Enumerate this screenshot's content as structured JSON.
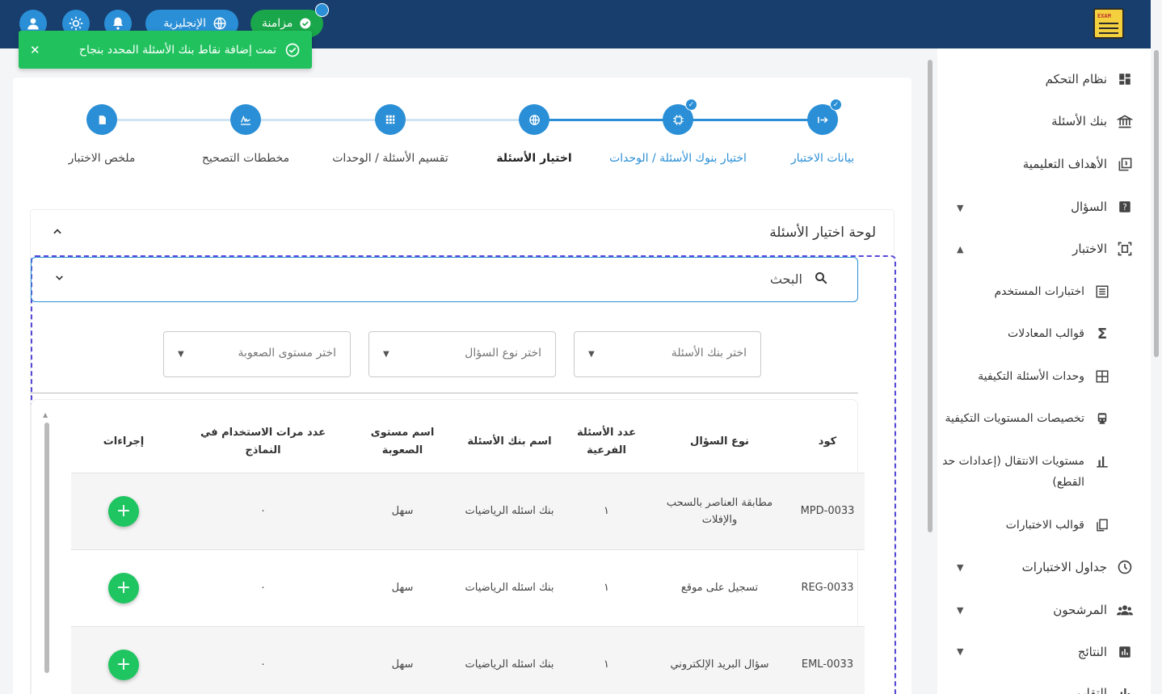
{
  "topbar": {
    "language_label": "الإنجليزية",
    "sync_label": "مزامنة",
    "logo_text": "EXAM",
    "icons": [
      "user-icon",
      "sun-icon",
      "bell-icon",
      "globe-icon",
      "check-circle-icon"
    ]
  },
  "toast": {
    "message": "تمت إضافة نقاط بنك الأسئلة المحدد بنجاح",
    "close": "✕"
  },
  "sidebar": {
    "items": [
      {
        "label": "نظام التحكم",
        "icon": "dashboard-icon"
      },
      {
        "label": "بنك الأسئلة",
        "icon": "bank-icon"
      },
      {
        "label": "الأهداف التعليمية",
        "icon": "objectives-icon"
      },
      {
        "label": "السؤال",
        "icon": "question-icon"
      },
      {
        "label": "الاختبار",
        "icon": "exam-icon"
      },
      {
        "label": "اختبارات المستخدم",
        "icon": "list-icon"
      },
      {
        "label": "قوالب المعادلات",
        "icon": "sigma-icon"
      },
      {
        "label": "وحدات الأسئلة التكيفية",
        "icon": "grid-icon"
      },
      {
        "label": "تخصيصات المستويات التكيفية",
        "icon": "train-icon"
      },
      {
        "label": "مستويات الانتقال (إعدادات حد القطع)",
        "icon": "bar-chart-icon"
      },
      {
        "label": "قوالب الاختبارات",
        "icon": "copy-icon"
      },
      {
        "label": "جداول الاختبارات",
        "icon": "clock-icon"
      },
      {
        "label": "المرشحون",
        "icon": "people-icon"
      },
      {
        "label": "النتائج",
        "icon": "chart-icon"
      },
      {
        "label": "التقارير",
        "icon": "report-icon"
      }
    ]
  },
  "stepper": {
    "steps": [
      {
        "label": "بيانات الاختبار",
        "icon": "arrow-icon",
        "state": "done"
      },
      {
        "label": "اختيار بنوك الأسئلة / الوحدات",
        "icon": "chip-icon",
        "state": "done"
      },
      {
        "label": "اختيار الأسئلة",
        "icon": "globe-icon",
        "state": "active"
      },
      {
        "label": "تقسيم الأسئلة / الوحدات",
        "icon": "grid-icon",
        "state": "pending"
      },
      {
        "label": "مخططات التصحيح",
        "icon": "signature-icon",
        "state": "pending"
      },
      {
        "label": "ملخص الاختبار",
        "icon": "doc-icon",
        "state": "pending"
      }
    ]
  },
  "panel": {
    "title": "لوحة اختيار الأسئلة",
    "search_label": "البحث",
    "filters": {
      "bank_placeholder": "اختر بنك الأسئلة",
      "type_placeholder": "اختر نوع السؤال",
      "level_placeholder": "اختر مستوى الصعوبة"
    }
  },
  "table": {
    "headers": {
      "code": "كود",
      "type": "نوع السؤال",
      "subcount": "عدد الأسئلة الفرعية",
      "bank": "اسم بنك الأسئلة",
      "level": "اسم مستوى الصعوبة",
      "usage": "عدد مرات الاستخدام في النماذج",
      "actions": "إجراءات"
    },
    "rows": [
      {
        "code": "MPD-0033",
        "type": "مطابقة العناصر بالسحب والإفلات",
        "subcount": "١",
        "bank": "بنك اسئله الرياضيات",
        "level": "سهل",
        "usage": "٠",
        "action": "+"
      },
      {
        "code": "REG-0033",
        "type": "تسجيل على موقع",
        "subcount": "١",
        "bank": "بنك اسئله الرياضيات",
        "level": "سهل",
        "usage": "٠",
        "action": "+"
      },
      {
        "code": "EML-0033",
        "type": "سؤال البريد الإلكتروني",
        "subcount": "١",
        "bank": "بنك اسئله الرياضيات",
        "level": "سهل",
        "usage": "٠",
        "action": "+"
      }
    ]
  }
}
